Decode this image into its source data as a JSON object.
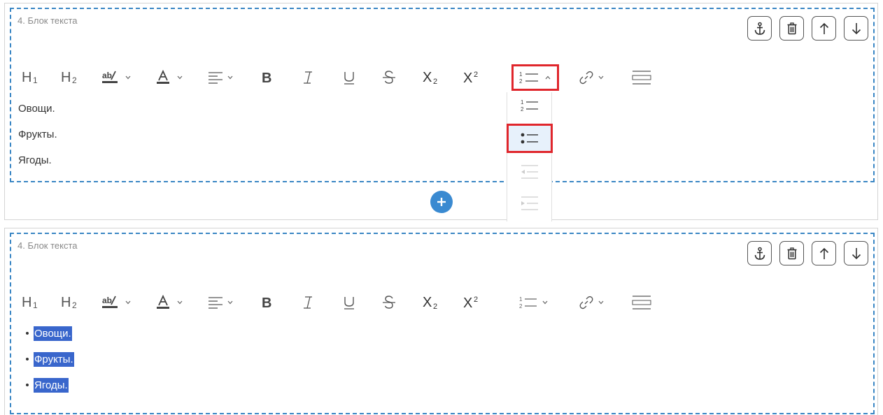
{
  "blocks": [
    {
      "title": "4. Блок текста",
      "lines": [
        "Овощи.",
        "Фрукты.",
        "Ягоды."
      ]
    },
    {
      "title": "4. Блок текста",
      "lines": [
        "Овощи.",
        "Фрукты.",
        "Ягоды."
      ]
    }
  ],
  "toolbar": {
    "h1": "H₁",
    "h2": "H₂",
    "items": [
      "heading-1",
      "heading-2",
      "highlight-color",
      "text-color",
      "align",
      "bold",
      "italic",
      "underline",
      "strikethrough",
      "subscript",
      "superscript",
      "list",
      "link",
      "horizontal-rule"
    ]
  },
  "block_tools": [
    "anchor-icon",
    "trash-icon",
    "arrow-up-icon",
    "arrow-down-icon"
  ],
  "list_dropdown": [
    "numbered-list-icon",
    "bulleted-list-icon",
    "outdent-icon",
    "indent-icon"
  ],
  "colors": {
    "dashed_border": "#3a86c4",
    "highlight_outline": "#e0262c",
    "selection": "#3966cc",
    "add_button": "#3a8ad1"
  }
}
